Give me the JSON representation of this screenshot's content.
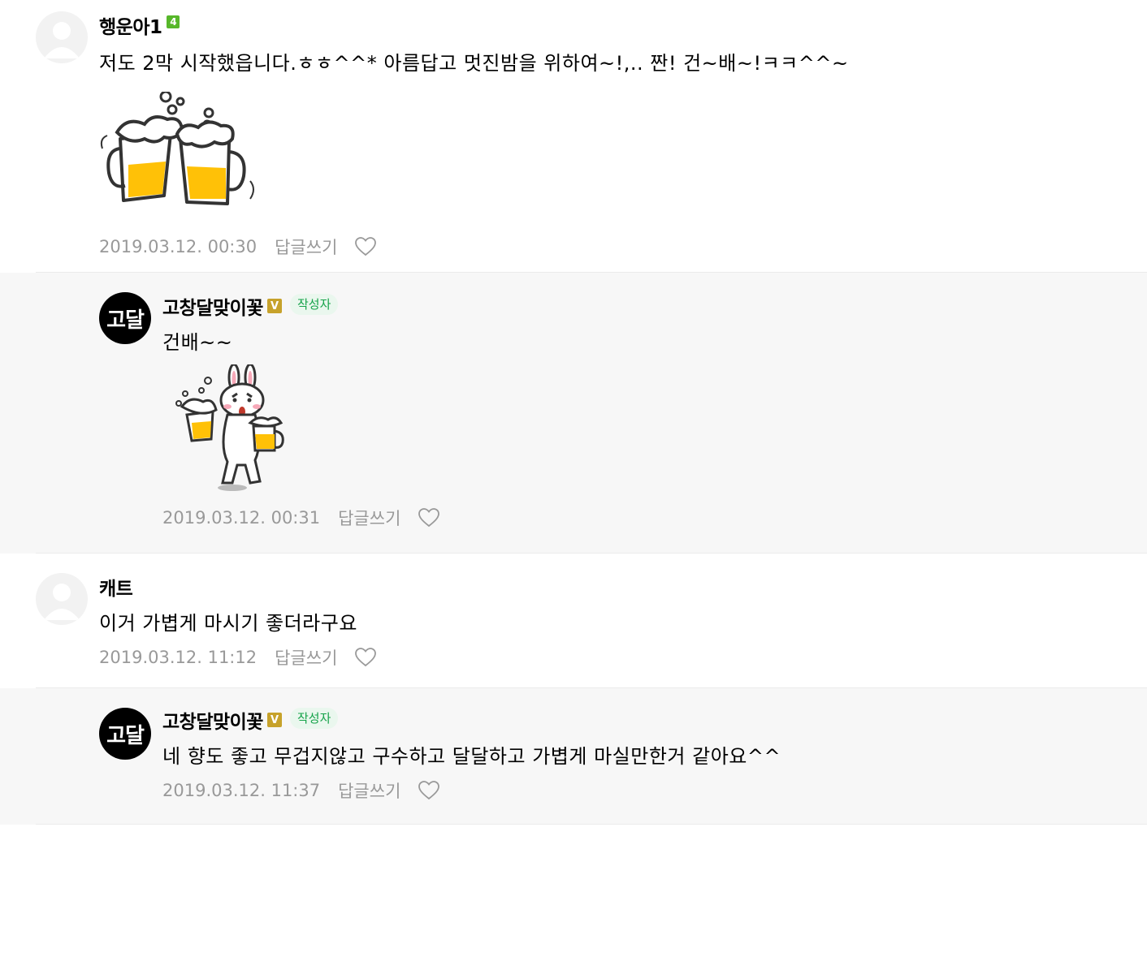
{
  "comments": [
    {
      "nickname": "행운아1",
      "level_badge": "4",
      "text": "저도 2막 시작했읍니다.ㅎㅎ^^* 아름답고 멋진밤을 위하여~!,.. 짠! 건~배~!ㅋㅋ^^~",
      "sticker": "beer-cheers-sticker",
      "date": "2019.03.12. 00:30",
      "reply_label": "답글쓰기",
      "like_icon": "heart-icon"
    },
    {
      "nickname": "고창달맞이꽃",
      "avatar_text": "고달",
      "verified_badge": "V",
      "author_tag": "작성자",
      "text": "건배~~",
      "sticker": "rabbit-beer-sticker",
      "date": "2019.03.12. 00:31",
      "reply_label": "답글쓰기",
      "like_icon": "heart-icon"
    },
    {
      "nickname": "캐트",
      "text": "이거 가볍게 마시기 좋더라구요",
      "date": "2019.03.12. 11:12",
      "reply_label": "답글쓰기",
      "like_icon": "heart-icon"
    },
    {
      "nickname": "고창달맞이꽃",
      "avatar_text": "고달",
      "verified_badge": "V",
      "author_tag": "작성자",
      "text": "네 향도 좋고 무겁지않고 구수하고 달달하고 가볍게 마실만한거 같아요^^",
      "date": "2019.03.12. 11:37",
      "reply_label": "답글쓰기",
      "like_icon": "heart-icon"
    }
  ],
  "colors": {
    "reply_background": "#f7f7f7",
    "level_badge": "#57b72a",
    "verified_badge": "#c7a22b",
    "author_tag_text": "#16a34a",
    "meta_text": "#999999",
    "beer": "#ffc107"
  }
}
